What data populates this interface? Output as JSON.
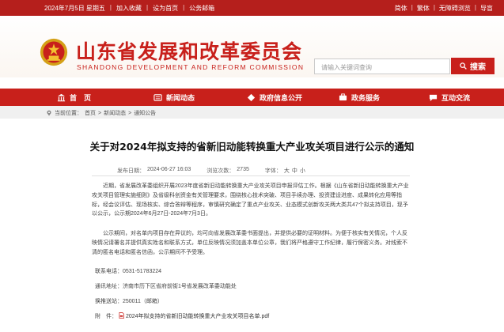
{
  "topbar": {
    "date": "2024年7月5日 星期五",
    "links_left": [
      "加入收藏",
      "设为首页",
      "公务邮箱"
    ],
    "links_right": [
      "简体",
      "繁体",
      "无障碍浏览",
      "导盲"
    ]
  },
  "header": {
    "title_cn": "山东省发展和改革委员会",
    "title_en": "SHANDONG DEVELOPMENT AND REFORM COMMISSION",
    "search_placeholder": "请输入关键词查询",
    "search_button": "搜索"
  },
  "nav": {
    "items": [
      {
        "label": "首　页",
        "icon": "government-building-icon"
      },
      {
        "label": "新闻动态",
        "icon": "news-icon"
      },
      {
        "label": "政府信息公开",
        "icon": "info-disclosure-icon"
      },
      {
        "label": "政务服务",
        "icon": "gov-service-icon"
      },
      {
        "label": "互动交流",
        "icon": "chat-icon"
      }
    ]
  },
  "breadcrumb": {
    "prefix": "当前位置：",
    "items": [
      "首页",
      "新闻动态",
      "通知公告"
    ],
    "separator": ">"
  },
  "article": {
    "title": "关于对2024年拟支持的省新旧动能转换重大产业攻关项目进行公示的通知",
    "publish_label": "发布日期：",
    "publish_time": "2024-06-27 16:03",
    "views_label": "浏览次数：",
    "views": "2735",
    "font_label": "字体：",
    "font_sizes": [
      "大",
      "中",
      "小"
    ],
    "paragraph1": "近期，省发展改革委组织开展2023年度省新旧动能转换重大产业攻关项目申报评估工作。根据《山东省新旧动能转换重大产业攻关项目管理实施细则》及省级科创资金有关管理要求，围绕核心技术突破、项目手续办理、投资建设进度、成果转化应用等指标，经会议评估、现场核实、综合答辩等程序，审慎研究确定了重点产业攻关、业态模式创新攻关两大类共47个拟支持项目，现予以公示，公示期2024年6月27日-2024年7月3日。",
    "paragraph2": "公示期间，对名单内项目存在异议的，均可向省发展改革委书面提出，并提供必要的证明材料。为便于核实有关情况，个人反映情况请署名并提供真实姓名和联系方式，单位反映情况须加盖本单位公章，我们将严格遵守工作纪律，履行保密义务。对线索不清的匿名电话和匿名信函，公示期间不予受理。",
    "phone_label": "联系电话：",
    "phone": "0531-51783224",
    "address_label": "通讯地址：",
    "address": "济南市历下区省府前街1号省发展改革委动能处",
    "zip_label": "换推送站：",
    "zip": "250011（邮箱）",
    "attachment_label": "附　件：",
    "attachment": "2024年拟支持的省新旧动能转换重大产业攻关项目名单.pdf"
  },
  "colors": {
    "brand_red": "#c8201b",
    "topbar_red": "#b51f1c"
  }
}
